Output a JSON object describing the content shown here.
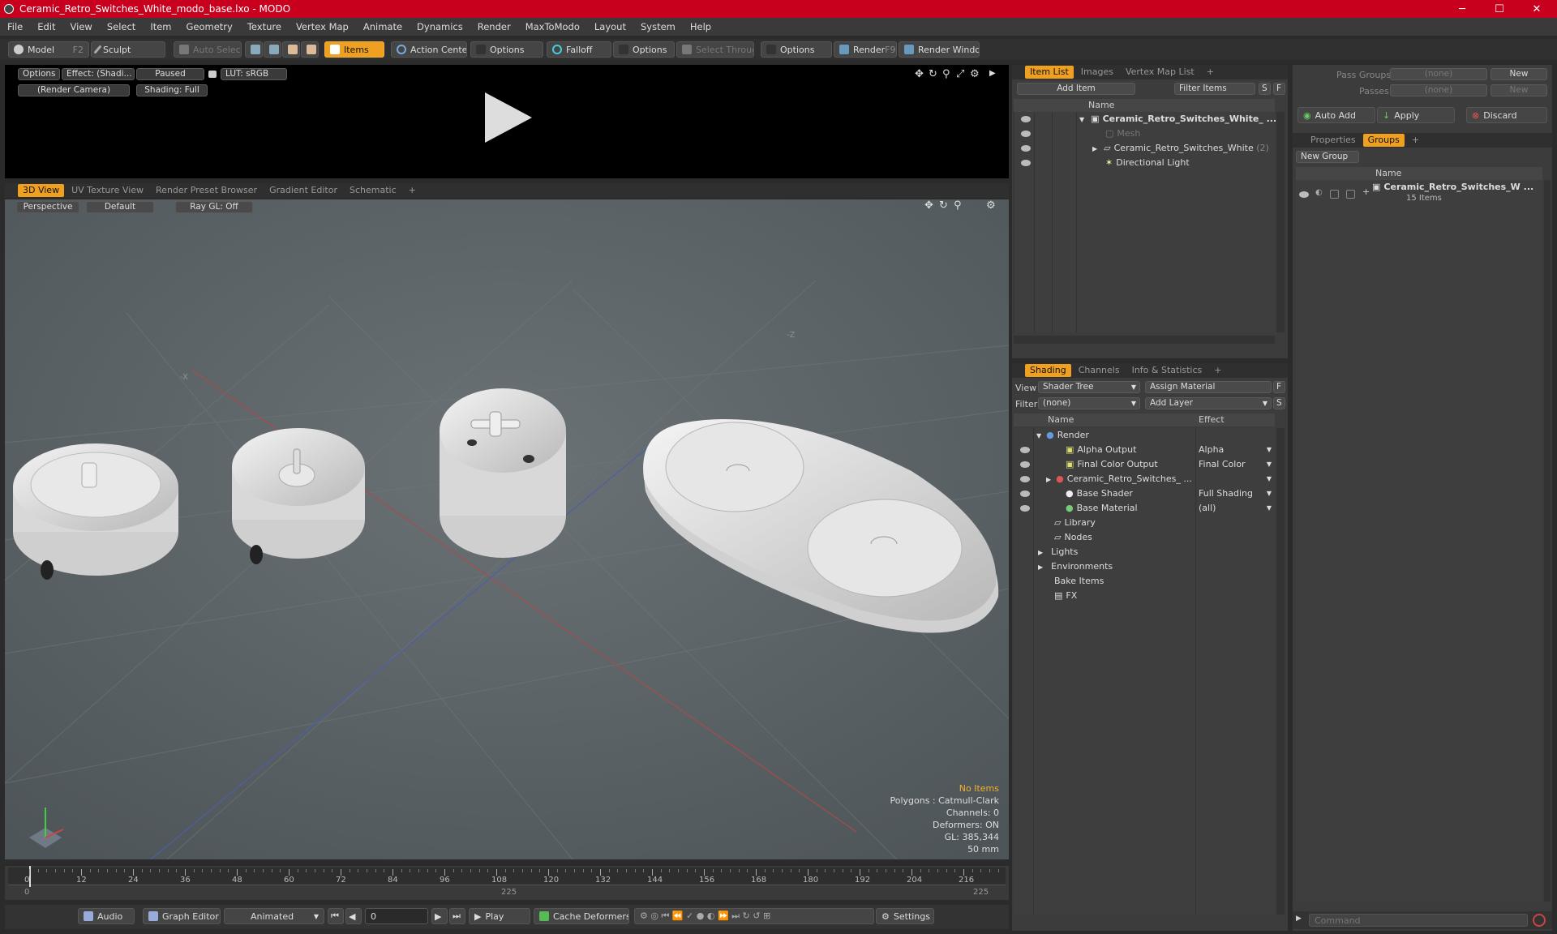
{
  "window": {
    "title": "Ceramic_Retro_Switches_White_modo_base.lxo - MODO",
    "min": "─",
    "max": "☐",
    "close": "✕"
  },
  "menu": [
    "File",
    "Edit",
    "View",
    "Select",
    "Item",
    "Geometry",
    "Texture",
    "Vertex Map",
    "Animate",
    "Dynamics",
    "Render",
    "MaxToModo",
    "Layout",
    "System",
    "Help"
  ],
  "toolbar": {
    "model": "Model",
    "model_key": "F2",
    "sculpt": "Sculpt",
    "auto_select": "Auto Select",
    "items": "Items",
    "action_center": "Action Center",
    "options1": "Options",
    "falloff": "Falloff",
    "options2": "Options",
    "select_through": "Select Through",
    "options3": "Options",
    "render": "Render",
    "render_key": "F9",
    "render_window": "Render Window"
  },
  "preview": {
    "options": "Options",
    "effect": "Effect: (Shadi...",
    "paused": "Paused",
    "lut": "LUT: sRGB",
    "camera": "(Render Camera)",
    "shading": "Shading: Full"
  },
  "viewport_tabs": [
    "3D View",
    "UV Texture View",
    "Render Preset Browser",
    "Gradient Editor",
    "Schematic"
  ],
  "viewport": {
    "perspective": "Perspective",
    "default": "Default",
    "raygl": "Ray GL: Off",
    "axis_x": "-X",
    "axis_z": "-Z",
    "stats": {
      "no_items": "No Items",
      "polygons": "Polygons : Catmull-Clark",
      "channels": "Channels: 0",
      "deformers": "Deformers: ON",
      "gl": "GL: 385,344",
      "mm": "50 mm"
    }
  },
  "timeline": {
    "ticks": [
      "0",
      "12",
      "24",
      "36",
      "48",
      "60",
      "72",
      "84",
      "96",
      "108",
      "120",
      "132",
      "144",
      "156",
      "168",
      "180",
      "192",
      "204",
      "216"
    ],
    "start": "0",
    "mid": "225",
    "end": "225"
  },
  "bottombar": {
    "audio": "Audio",
    "graph_editor": "Graph Editor",
    "animated": "Animated",
    "frame": "0",
    "play": "Play",
    "cache": "Cache Deformers",
    "settings": "Settings"
  },
  "itemlist": {
    "tabs": [
      "Item List",
      "Images",
      "Vertex Map List"
    ],
    "add_item": "Add Item",
    "filter": "Filter Items",
    "s": "S",
    "f": "F",
    "col_name": "Name",
    "rows": [
      "Ceramic_Retro_Switches_White_ ...",
      "Mesh",
      "Ceramic_Retro_Switches_White",
      "(2)",
      "Directional Light"
    ]
  },
  "shading": {
    "tabs": [
      "Shading",
      "Channels",
      "Info & Statistics"
    ],
    "view_label": "View",
    "view_value": "Shader Tree",
    "assign": "Assign Material",
    "f": "F",
    "filter_label": "Filter",
    "filter_value": "(none)",
    "add_layer": "Add Layer",
    "s": "S",
    "col_name": "Name",
    "col_effect": "Effect",
    "rows": [
      {
        "name": "Render",
        "effect": ""
      },
      {
        "name": "Alpha Output",
        "effect": "Alpha"
      },
      {
        "name": "Final Color Output",
        "effect": "Final Color"
      },
      {
        "name": "Ceramic_Retro_Switches_ ...",
        "effect": ""
      },
      {
        "name": "Base Shader",
        "effect": "Full Shading"
      },
      {
        "name": "Base Material",
        "effect": "(all)"
      },
      {
        "name": "Library",
        "effect": ""
      },
      {
        "name": "Nodes",
        "effect": ""
      },
      {
        "name": "Lights",
        "effect": ""
      },
      {
        "name": "Environments",
        "effect": ""
      },
      {
        "name": "Bake Items",
        "effect": ""
      },
      {
        "name": "FX",
        "effect": ""
      }
    ]
  },
  "groups": {
    "pass_groups": "Pass Groups",
    "passes": "Passes",
    "none1": "(none)",
    "none2": "(none)",
    "new1": "New",
    "new2": "New",
    "auto_add": "Auto Add",
    "apply": "Apply",
    "discard": "Discard",
    "tabs": [
      "Properties",
      "Groups"
    ],
    "new_group": "New Group",
    "col_name": "Name",
    "group_name": "Ceramic_Retro_Switches_W ...",
    "group_count": "15 Items"
  },
  "command": {
    "placeholder": "Command"
  }
}
